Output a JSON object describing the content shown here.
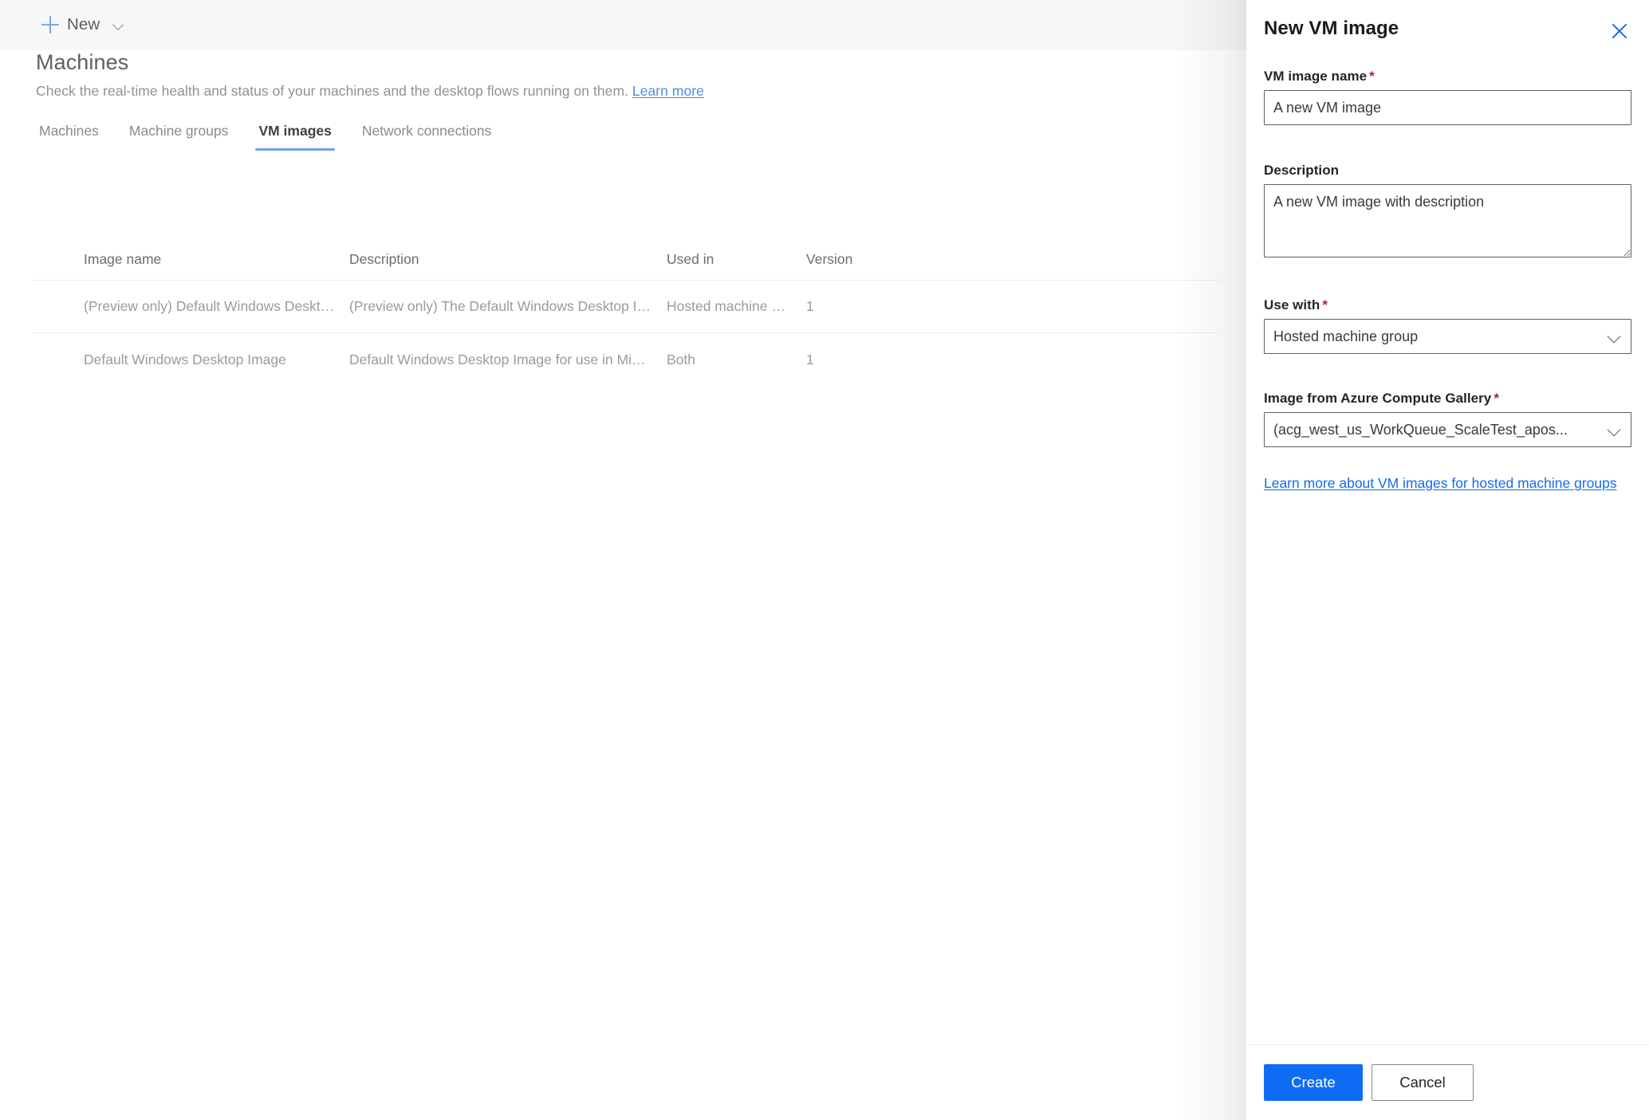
{
  "command_bar": {
    "new_label": "New",
    "new_icon": "plus-icon",
    "chevron_icon": "chevron-down-icon"
  },
  "page": {
    "title": "Machines",
    "subtitle": "Check the real-time health and status of your machines and the desktop flows running on them.",
    "learn_more_label": "Learn more"
  },
  "tabs": [
    {
      "label": "Machines",
      "active": false
    },
    {
      "label": "Machine groups",
      "active": false
    },
    {
      "label": "VM images",
      "active": true
    },
    {
      "label": "Network connections",
      "active": false
    }
  ],
  "table": {
    "columns": [
      "Image name",
      "Description",
      "Used in",
      "Version"
    ],
    "rows": [
      {
        "image_name": "(Preview only) Default Windows Desktop Ima...",
        "description": "(Preview only) The Default Windows Desktop Image for use i...",
        "used_in": "Hosted machine group",
        "version": "1"
      },
      {
        "image_name": "Default Windows Desktop Image",
        "description": "Default Windows Desktop Image for use in Microsoft Deskto...",
        "used_in": "Both",
        "version": "1"
      }
    ]
  },
  "panel": {
    "title": "New VM image",
    "close_icon": "close-icon",
    "fields": {
      "vm_image_name": {
        "label": "VM image name",
        "required_marker": "*",
        "value": "A new VM image"
      },
      "description": {
        "label": "Description",
        "value": "A new VM image with description"
      },
      "use_with": {
        "label": "Use with",
        "required_marker": "*",
        "value": "Hosted machine group",
        "chevron_icon": "chevron-down-icon"
      },
      "image_from_gallery": {
        "label": "Image from Azure Compute Gallery",
        "required_marker": "*",
        "value": "(acg_west_us_WorkQueue_ScaleTest_apos...",
        "chevron_icon": "chevron-down-icon"
      }
    },
    "learn_link_label": "Learn more about VM images for hosted machine groups",
    "footer": {
      "create_label": "Create",
      "cancel_label": "Cancel"
    }
  },
  "colors": {
    "accent_blue": "#0f6cf5",
    "tab_underline": "#6ba2e8",
    "required_red": "#a4262c",
    "link_blue": "#4d8ce0",
    "command_bar_bg": "#f7f7f7"
  }
}
